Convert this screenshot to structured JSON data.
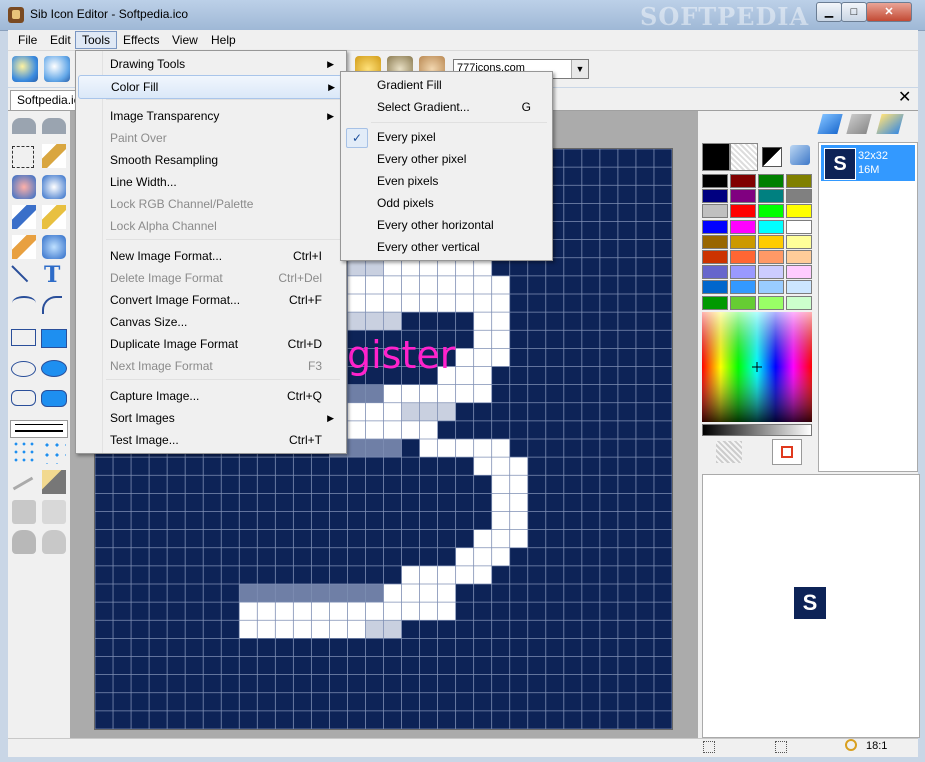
{
  "window": {
    "title": "Sib Icon Editor - Softpedia.ico",
    "watermark": "SOFTPEDIA",
    "minimize": "▁",
    "maximize": "□",
    "close": "✕"
  },
  "menubar": [
    "File",
    "Edit",
    "Tools",
    "Effects",
    "View",
    "Help"
  ],
  "toolbar": {
    "source_combo_value": "777icons.com",
    "combo_arrow": "▼"
  },
  "tabs": {
    "document_tab": "Softpedia.ico",
    "close_tab": "✕"
  },
  "tools_menu": {
    "items": [
      {
        "label": "Drawing Tools",
        "shortcut": "",
        "submenu": true,
        "disabled": false
      },
      {
        "label": "Color Fill",
        "shortcut": "",
        "submenu": true,
        "disabled": false,
        "highlighted": true
      },
      {
        "label": "Image Transparency",
        "shortcut": "",
        "submenu": true,
        "disabled": false
      },
      {
        "label": "Paint Over",
        "shortcut": "",
        "submenu": false,
        "disabled": true
      },
      {
        "label": "Smooth Resampling",
        "shortcut": "",
        "submenu": false,
        "disabled": false
      },
      {
        "label": "Line Width...",
        "shortcut": "",
        "submenu": false,
        "disabled": false
      },
      {
        "label": "Lock RGB Channel/Palette",
        "shortcut": "",
        "submenu": false,
        "disabled": true
      },
      {
        "label": "Lock Alpha Channel",
        "shortcut": "",
        "submenu": false,
        "disabled": true
      },
      {
        "label": "New Image Format...",
        "shortcut": "Ctrl+I",
        "submenu": false,
        "disabled": false
      },
      {
        "label": "Delete Image Format",
        "shortcut": "Ctrl+Del",
        "submenu": false,
        "disabled": true
      },
      {
        "label": "Convert Image Format...",
        "shortcut": "Ctrl+F",
        "submenu": false,
        "disabled": false
      },
      {
        "label": "Canvas Size...",
        "shortcut": "",
        "submenu": false,
        "disabled": false
      },
      {
        "label": "Duplicate Image Format",
        "shortcut": "Ctrl+D",
        "submenu": false,
        "disabled": false
      },
      {
        "label": "Next Image Format",
        "shortcut": "F3",
        "submenu": false,
        "disabled": true
      },
      {
        "label": "Capture Image...",
        "shortcut": "Ctrl+Q",
        "submenu": false,
        "disabled": false
      },
      {
        "label": "Sort Images",
        "shortcut": "",
        "submenu": true,
        "disabled": false
      },
      {
        "label": "Test Image...",
        "shortcut": "Ctrl+T",
        "submenu": false,
        "disabled": false
      }
    ]
  },
  "color_fill_submenu": {
    "items": [
      {
        "label": "Gradient Fill",
        "shortcut": ""
      },
      {
        "label": "Select Gradient...",
        "shortcut": "G"
      },
      {
        "label": "Every pixel",
        "shortcut": "",
        "checked": true
      },
      {
        "label": "Every other pixel",
        "shortcut": ""
      },
      {
        "label": "Even pixels",
        "shortcut": ""
      },
      {
        "label": "Odd pixels",
        "shortcut": ""
      },
      {
        "label": "Every other horizontal",
        "shortcut": ""
      },
      {
        "label": "Every other vertical",
        "shortcut": ""
      }
    ],
    "check_glyph": "✓"
  },
  "canvas": {
    "overlay_text": "gister",
    "background_color": "#0d2357"
  },
  "icon_list": {
    "item_letter": "S",
    "item_size": "32x32",
    "item_colors": "16M"
  },
  "preview": {
    "letter": "S"
  },
  "palette": {
    "current_colors": [
      "#000000",
      "#ffffff"
    ],
    "swatches": [
      "#000000",
      "#800000",
      "#008000",
      "#808000",
      "#000080",
      "#800080",
      "#008080",
      "#808080",
      "#c0c0c0",
      "#ff0000",
      "#00ff00",
      "#ffff00",
      "#0000ff",
      "#ff00ff",
      "#00ffff",
      "#ffffff",
      "#996600",
      "#cc9900",
      "#ffcc00",
      "#ffff99",
      "#cc3300",
      "#ff6633",
      "#ff9966",
      "#ffcc99",
      "#6666cc",
      "#9999ff",
      "#ccccff",
      "#ffccff",
      "#0066cc",
      "#3399ff",
      "#99ccff",
      "#cce6ff",
      "#009900",
      "#66cc33",
      "#99ff66",
      "#ccffcc"
    ]
  },
  "statusbar": {
    "zoom": "18:1"
  }
}
